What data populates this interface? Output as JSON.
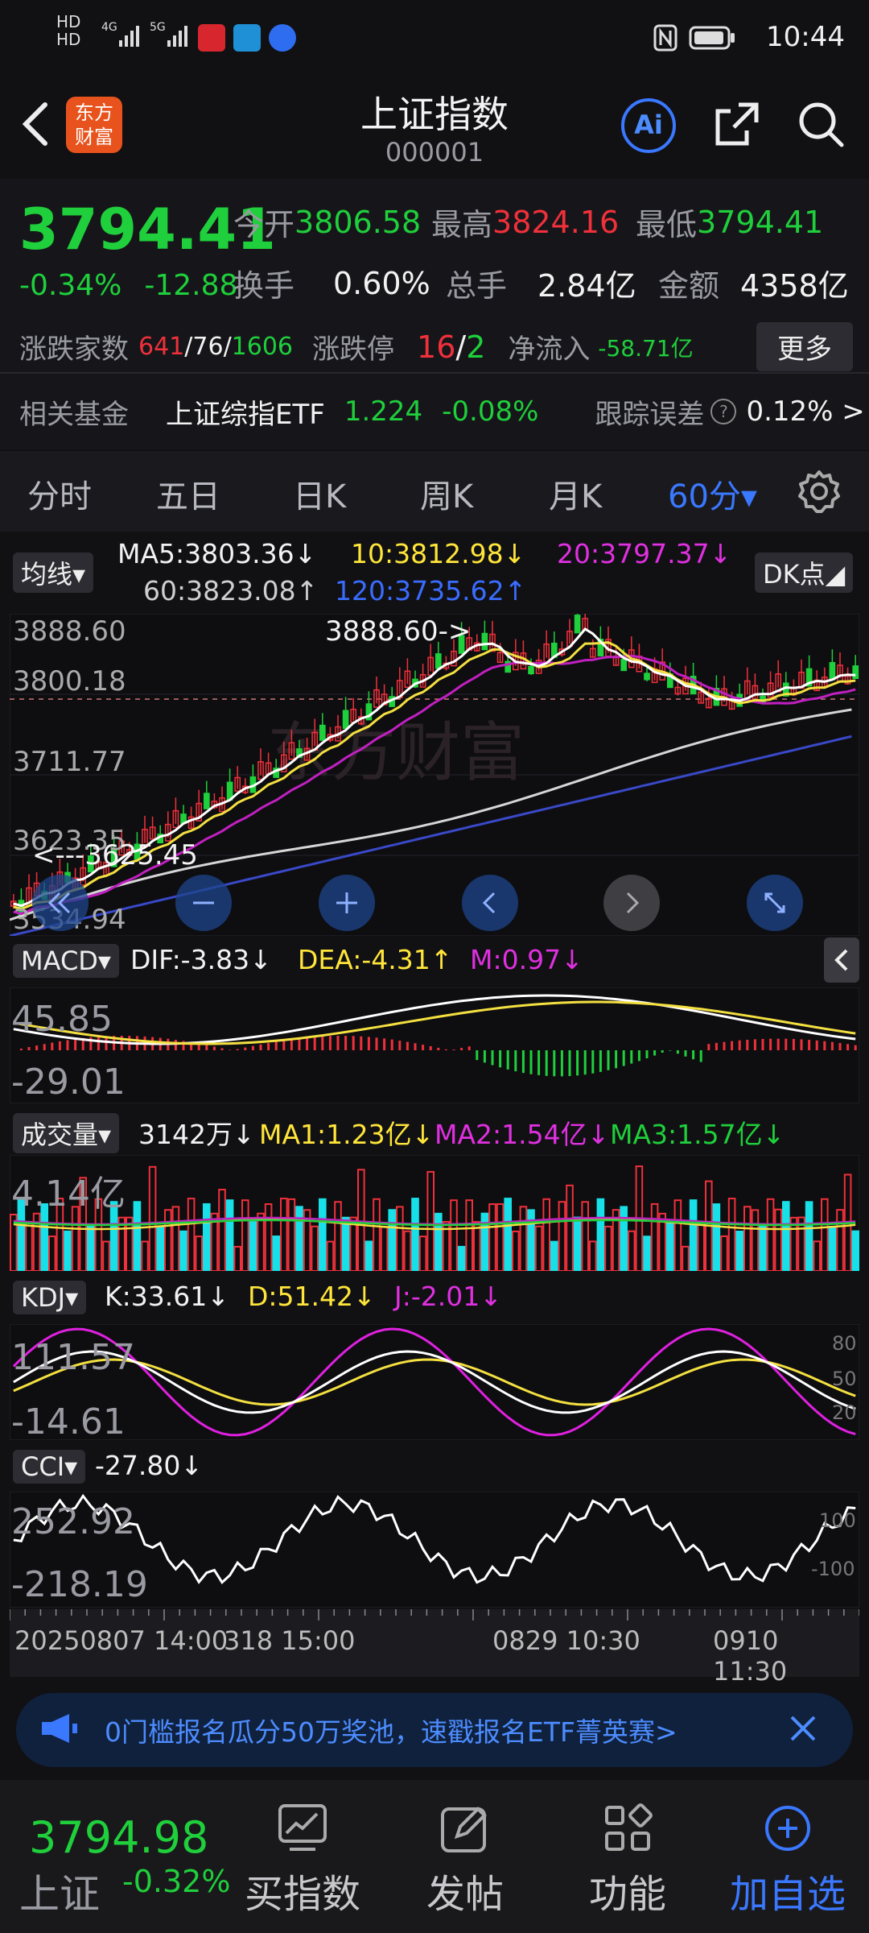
{
  "status": {
    "time": "10:44",
    "left_icons": [
      "hd-icon",
      "4g-signal-icon",
      "5g-signal-icon",
      "app-notification-icon",
      "app-notification-icon",
      "app-notification-icon"
    ],
    "battery": "battery-icon"
  },
  "header": {
    "title": "上证指数",
    "code": "000001",
    "logo_line1": "东方",
    "logo_line2": "财富",
    "ai_label": "Ai"
  },
  "quote": {
    "price": "3794.41",
    "pct": "-0.34%",
    "chg": "-12.88",
    "open_label": "今开",
    "open": "3806.58",
    "high_label": "最高",
    "high": "3824.16",
    "low_label": "最低",
    "low": "3794.41",
    "turnover_label": "换手",
    "turnover": "0.60%",
    "volume_label": "总手",
    "volume": "2.84亿",
    "amount_label": "金额",
    "amount": "4358亿",
    "breadth_label": "涨跌家数",
    "breadth_up": "641",
    "breadth_sep1": "/",
    "breadth_flat": "76",
    "breadth_sep2": "/",
    "breadth_down": "1606",
    "limit_label": "涨跌停",
    "limit_up": "16",
    "limit_sep": "/",
    "limit_down": "2",
    "inflow_label": "净流入",
    "inflow": "-58.71亿",
    "more_button": "更多"
  },
  "fund": {
    "label": "相关基金",
    "name": "上证综指ETF",
    "price": "1.224",
    "pct": "-0.08%",
    "track_label": "跟踪误差",
    "track_value": "0.12% >"
  },
  "tabs": [
    {
      "label": "分时"
    },
    {
      "label": "五日"
    },
    {
      "label": "日K"
    },
    {
      "label": "周K"
    },
    {
      "label": "月K"
    },
    {
      "label": "60分▾"
    }
  ],
  "ma_bar": {
    "selector": "均线▾",
    "ma5": "MA5:3803.36↓",
    "ma10": "10:3812.98↓",
    "ma20": "20:3797.37↓",
    "ma60": "60:3823.08↑",
    "ma120": "120:3735.62↑",
    "dk_button": "DK点◢"
  },
  "kline": {
    "y_ticks": [
      "3888.60",
      "3800.18",
      "3711.77",
      "3623.35",
      "3534.94"
    ],
    "high_marker": "3888.60->",
    "low_marker": "<---3625.45",
    "watermark": "东方财富"
  },
  "macd": {
    "selector": "MACD▾",
    "dif": "DIF:-3.83↓",
    "dea": "DEA:-4.31↑",
    "m": "M:0.97↓",
    "top": "45.85",
    "bottom": "-29.01"
  },
  "volume": {
    "selector": "成交量▾",
    "vol": "3142万↓",
    "ma1": "MA1:1.23亿↓",
    "ma2": "MA2:1.54亿↓",
    "ma3": "MA3:1.57亿↓",
    "top": "4.14亿"
  },
  "kdj": {
    "selector": "KDJ▾",
    "k": "K:33.61↓",
    "d": "D:51.42↓",
    "j": "J:-2.01↓",
    "top": "111.57",
    "bottom": "-14.61",
    "r80": "80",
    "r50": "50",
    "r20": "20"
  },
  "cci": {
    "selector": "CCI▾",
    "value": "-27.80↓",
    "top": "252.92",
    "bottom": "-218.19",
    "r100": "100",
    "rm100": "-100"
  },
  "time_axis": {
    "t1": "20250807 14:00",
    "t1b": "318 15:00",
    "t2": "0829 10:30",
    "t3": "0910 11:30"
  },
  "banner": {
    "text": "0门槛报名瓜分50万奖池，速戳报名ETF菁英赛>"
  },
  "bottom": {
    "price": "3794.98",
    "name": "上证",
    "pct": "-0.32%",
    "items": [
      {
        "label": "买指数"
      },
      {
        "label": "发帖"
      },
      {
        "label": "功能"
      },
      {
        "label": "加自选"
      }
    ]
  },
  "colors": {
    "up": "#f0303a",
    "down": "#1fcf3b",
    "accent": "#3a78ff",
    "bg": "#111114"
  }
}
